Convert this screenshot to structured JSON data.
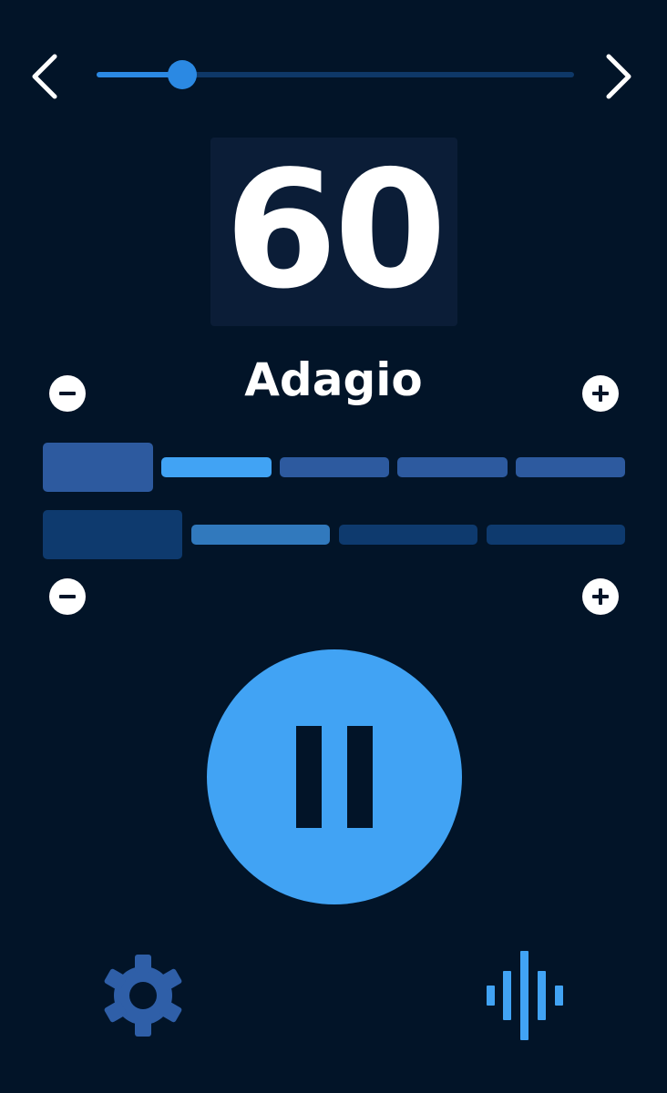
{
  "colors": {
    "background": "#021428",
    "accent": "#41a3f4",
    "slider": "#2b89e3",
    "tempo_box": "#0b1d37",
    "gear": "#2f5fa8"
  },
  "tempo": {
    "value": "60",
    "name": "Adagio",
    "slider_fraction": 0.17
  },
  "icons": {
    "prev": "chevron-left-icon",
    "next": "chevron-right-icon",
    "minus": "minus-icon",
    "plus": "plus-icon",
    "pause": "pause-icon",
    "settings": "gear-icon",
    "sound": "sound-wave-icon"
  },
  "rows": {
    "top": {
      "beats": [
        {
          "state": "accent"
        },
        {
          "state": "active"
        },
        {
          "state": "normal"
        },
        {
          "state": "normal"
        },
        {
          "state": "normal"
        }
      ]
    },
    "bottom": {
      "beats": [
        {
          "state": "accent"
        },
        {
          "state": "active"
        },
        {
          "state": "normal"
        },
        {
          "state": "normal"
        }
      ]
    }
  },
  "player": {
    "state": "playing"
  }
}
